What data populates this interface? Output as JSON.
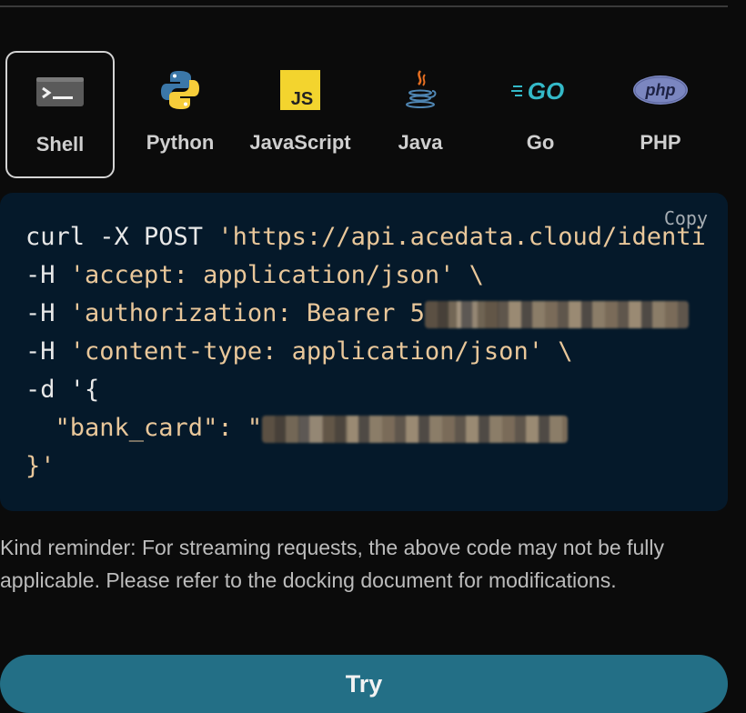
{
  "tabs": [
    {
      "label": "Shell",
      "icon": "terminal-icon",
      "active": true
    },
    {
      "label": "Python",
      "icon": "python-icon",
      "active": false
    },
    {
      "label": "JavaScript",
      "icon": "javascript-icon",
      "active": false
    },
    {
      "label": "Java",
      "icon": "java-icon",
      "active": false
    },
    {
      "label": "Go",
      "icon": "go-icon",
      "active": false
    },
    {
      "label": "PHP",
      "icon": "php-icon",
      "active": false
    }
  ],
  "code_panel": {
    "copy_label": "Copy",
    "lines": {
      "l1_cmd": "curl -X POST ",
      "l1_url": "'https://api.acedata.cloud/identi",
      "l2_flag": "-H ",
      "l2_val": "'accept: application/json' \\",
      "l3_flag": "-H ",
      "l3_val": "'authorization: Bearer 5",
      "l4_flag": "-H ",
      "l4_val": "'content-type: application/json' \\",
      "l5": "-d '{",
      "l6_key": "  \"bank_card\": \"",
      "l7": "}'"
    }
  },
  "reminder": "Kind reminder: For streaming requests, the above code may not be fully applicable. Please refer to the docking document for modifications.",
  "try_label": "Try",
  "colors": {
    "background": "#0b0b0b",
    "code_bg": "#05192a",
    "string": "#e9c79a",
    "try_button": "#236f86"
  }
}
